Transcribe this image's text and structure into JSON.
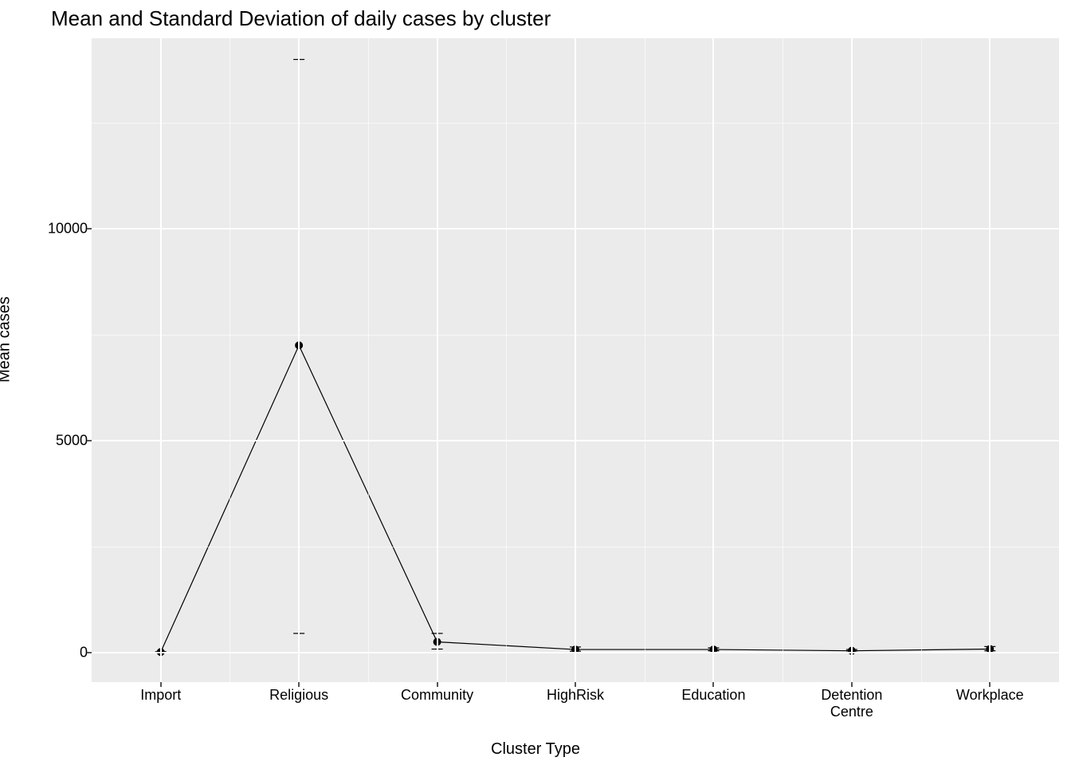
{
  "chart_data": {
    "type": "line",
    "title": "Mean and Standard Deviation of daily cases by cluster",
    "xlabel": "Cluster Type",
    "ylabel": "Mean cases",
    "categories": [
      "Import",
      "Religious",
      "Community",
      "HighRisk",
      "Education",
      "Detention\nCentre",
      "Workplace"
    ],
    "values": [
      10,
      7250,
      250,
      70,
      70,
      40,
      80
    ],
    "error_low": [
      0,
      450,
      80,
      30,
      40,
      10,
      40
    ],
    "error_high": [
      20,
      14000,
      450,
      130,
      110,
      70,
      140
    ],
    "y_ticks": [
      0,
      5000,
      10000
    ],
    "ylim": [
      -700,
      14500
    ]
  }
}
